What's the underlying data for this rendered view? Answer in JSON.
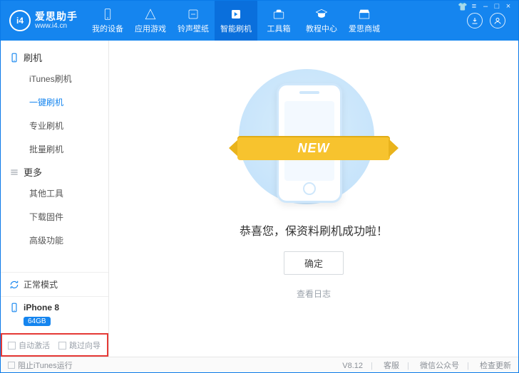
{
  "app": {
    "name": "爱思助手",
    "site": "www.i4.cn",
    "version": "V8.12"
  },
  "winControls": {
    "skin": "👕",
    "menu": "≡",
    "minimize": "–",
    "maximize": "□",
    "close": "×"
  },
  "nav": [
    {
      "key": "device",
      "label": "我的设备"
    },
    {
      "key": "apps",
      "label": "应用游戏"
    },
    {
      "key": "ringtone",
      "label": "铃声壁纸"
    },
    {
      "key": "flash",
      "label": "智能刷机",
      "active": true
    },
    {
      "key": "toolbox",
      "label": "工具箱"
    },
    {
      "key": "tutorial",
      "label": "教程中心"
    },
    {
      "key": "store",
      "label": "爱思商城"
    }
  ],
  "sidebar": {
    "group1": {
      "title": "刷机",
      "items": [
        {
          "label": "iTunes刷机"
        },
        {
          "label": "一键刷机",
          "active": true
        },
        {
          "label": "专业刷机"
        },
        {
          "label": "批量刷机"
        }
      ]
    },
    "group2": {
      "title": "更多",
      "items": [
        {
          "label": "其他工具"
        },
        {
          "label": "下载固件"
        },
        {
          "label": "高级功能"
        }
      ]
    },
    "status": {
      "label": "正常模式"
    },
    "device": {
      "name": "iPhone 8",
      "storage": "64GB"
    },
    "checks": {
      "autoActivate": "自动激活",
      "skipSetup": "跳过向导"
    }
  },
  "main": {
    "ribbon": "NEW",
    "title": "恭喜您，保资料刷机成功啦！",
    "ok": "确定",
    "viewLog": "查看日志"
  },
  "footer": {
    "blockItunes": "阻止iTunes运行",
    "support": "客服",
    "wechat": "微信公众号",
    "update": "检查更新"
  }
}
